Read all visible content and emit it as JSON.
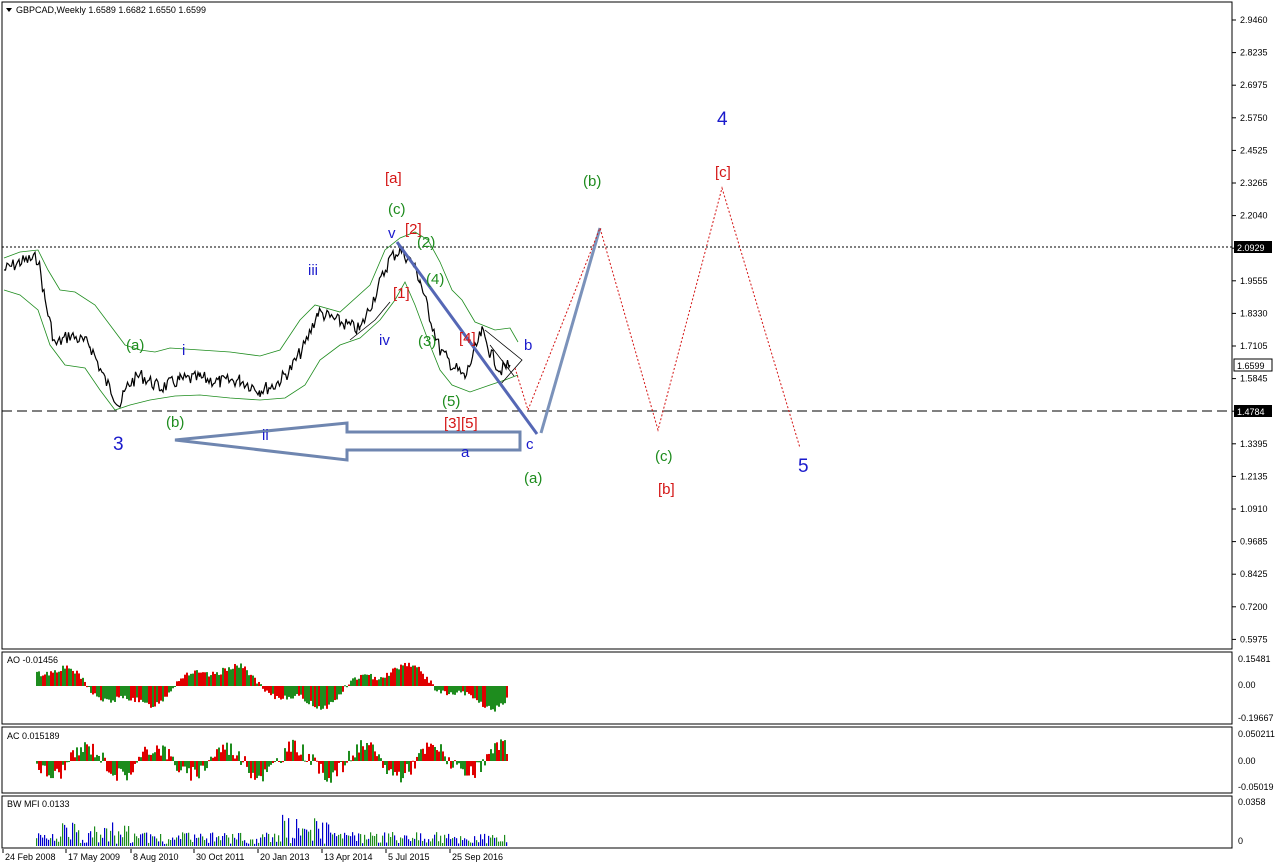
{
  "main": {
    "title": "GBPCAD,Weekly  1.6589 1.6682 1.6550 1.6599",
    "price_ticks": [
      "2.9460",
      "2.8235",
      "2.6975",
      "2.5750",
      "2.4525",
      "2.3265",
      "2.2040",
      "2.0815",
      "1.9555",
      "1.8330",
      "1.7105",
      "1.5845",
      "1.4620",
      "1.3395",
      "1.2135",
      "1.0910",
      "0.9685",
      "0.8425",
      "0.7200",
      "0.5975"
    ],
    "current_price": "1.6599",
    "line_high": "2.0929",
    "line_low": "1.4784"
  },
  "wave_labels": [
    {
      "text": "3",
      "color": "#1a1acc",
      "size": "big"
    },
    {
      "text": "(a)",
      "color": "#1e8c1e"
    },
    {
      "text": "(b)",
      "color": "#1e8c1e"
    },
    {
      "text": "i",
      "color": "#1a1acc"
    },
    {
      "text": "ii",
      "color": "#1a1acc"
    },
    {
      "text": "iii",
      "color": "#1a1acc"
    },
    {
      "text": "iv",
      "color": "#1a1acc"
    },
    {
      "text": "v",
      "color": "#1a1acc"
    },
    {
      "text": "[a]",
      "color": "#d41515"
    },
    {
      "text": "(c)",
      "color": "#1e8c1e"
    },
    {
      "text": "[2]",
      "color": "#d41515"
    },
    {
      "text": "(2)",
      "color": "#1e8c1e"
    },
    {
      "text": "[1]",
      "color": "#d41515"
    },
    {
      "text": "(4)",
      "color": "#1e8c1e"
    },
    {
      "text": "(3)",
      "color": "#1e8c1e"
    },
    {
      "text": "[4]",
      "color": "#d41515"
    },
    {
      "text": "(5)",
      "color": "#1e8c1e"
    },
    {
      "text": "[3]",
      "color": "#d41515"
    },
    {
      "text": "[5]",
      "color": "#d41515"
    },
    {
      "text": "a",
      "color": "#1a1acc"
    },
    {
      "text": "b",
      "color": "#1a1acc"
    },
    {
      "text": "c",
      "color": "#1a1acc"
    },
    {
      "text": "(a)",
      "color": "#1e8c1e"
    },
    {
      "text": "(b)",
      "color": "#1e8c1e"
    },
    {
      "text": "(c)",
      "color": "#1e8c1e"
    },
    {
      "text": "[b]",
      "color": "#d41515"
    },
    {
      "text": "[c]",
      "color": "#d41515"
    },
    {
      "text": "4",
      "color": "#1a1acc",
      "size": "big"
    },
    {
      "text": "5",
      "color": "#1a1acc",
      "size": "big"
    }
  ],
  "ao": {
    "title": "AO -0.01456",
    "ticks": [
      "0.15481",
      "0.00",
      "-0.19667"
    ]
  },
  "ac": {
    "title": "AC 0.015189",
    "ticks": [
      "0.050211",
      "0.00",
      "-0.05019"
    ]
  },
  "mfi": {
    "title": "BW MFI 0.0133",
    "ticks": [
      "0.0358",
      "0"
    ]
  },
  "time_axis": [
    "24 Feb 2008",
    "17 May 2009",
    "8 Aug 2010",
    "30 Oct 2011",
    "20 Jan 2013",
    "13 Apr 2014",
    "5 Jul 2015",
    "25 Sep 2016"
  ],
  "colors": {
    "up": "#1e8c1e",
    "down": "#e00000",
    "wave_blue": "#1a1acc",
    "projection": "#d41515",
    "arrow": "#6f86b0",
    "mfi_blue": "#0000cc",
    "mfi_green": "#1e8c1e"
  }
}
